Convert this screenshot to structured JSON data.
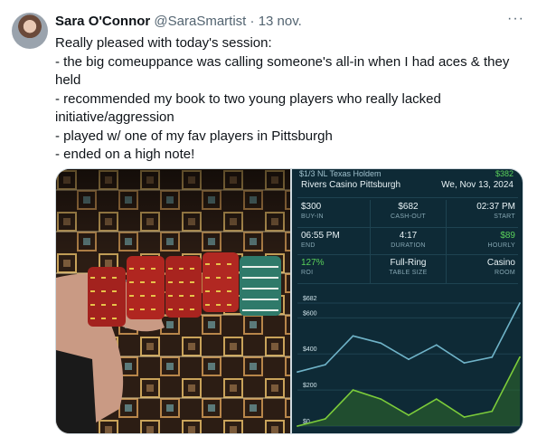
{
  "tweet": {
    "author_name": "Sara O'Connor",
    "handle": "@SaraSmartist",
    "separator": "·",
    "date": "13 nov.",
    "more_label": "···",
    "lines": [
      "Really pleased with today's session:",
      "- the big comeuppance was calling someone's all-in when I had aces & they held",
      "- recommended my book to two young players who really lacked initiative/aggression",
      "- played w/ one of my fav players in Pittsburgh",
      "- ended on a high note!"
    ]
  },
  "session": {
    "game": "$1/3 NL Texas Holdem",
    "top_amount": "$382",
    "venue": "Rivers Casino Pittsburgh",
    "date": "We, Nov 13, 2024",
    "stats": [
      {
        "value": "$300",
        "label": "BUY-IN"
      },
      {
        "value": "$682",
        "label": "CASH-OUT"
      },
      {
        "value": "02:37 PM",
        "label": "START"
      },
      {
        "value": "06:55 PM",
        "label": "END"
      },
      {
        "value": "4:17",
        "label": "DURATION"
      },
      {
        "value": "$89",
        "label": "HOURLY",
        "highlight": true
      },
      {
        "value": "127%",
        "label": "ROI",
        "highlight": true
      },
      {
        "value": "Full-Ring",
        "label": "TABLE SIZE"
      },
      {
        "value": "Casino",
        "label": "ROOM"
      }
    ],
    "colors": {
      "positive": "#5ad05a",
      "panel": "#0e2a36",
      "line_blue": "#6fb3c8",
      "line_green": "#7ccc3a"
    }
  },
  "chart_data": {
    "type": "line",
    "y_tick_labels": [
      "$682",
      "$600",
      "$400",
      "$200",
      "$0"
    ],
    "y_ticks": [
      682,
      600,
      400,
      200,
      0
    ],
    "ylim": [
      0,
      682
    ],
    "x": [
      0,
      1,
      2,
      3,
      4,
      5,
      6,
      7,
      8
    ],
    "series": [
      {
        "color": "#6fb3c8",
        "values": [
          300,
          340,
          500,
          460,
          370,
          450,
          350,
          382,
          682
        ]
      },
      {
        "color": "#7ccc3a",
        "values": [
          0,
          40,
          200,
          150,
          60,
          150,
          50,
          82,
          382
        ]
      }
    ],
    "grid": true
  }
}
